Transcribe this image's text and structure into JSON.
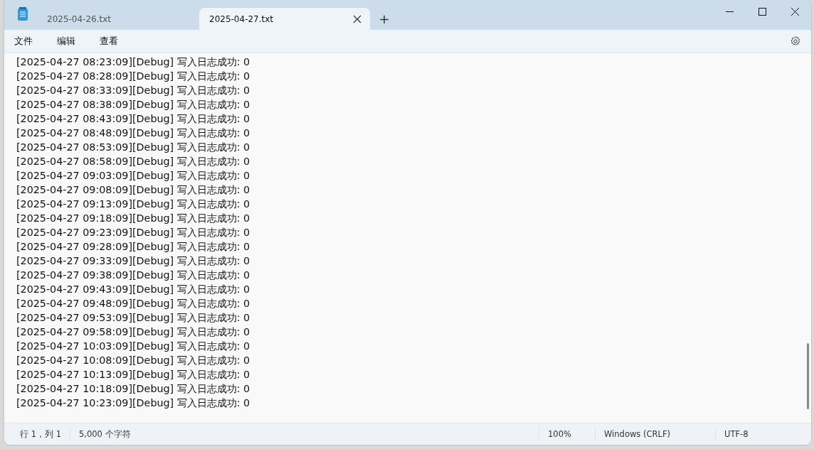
{
  "tabs": [
    {
      "label": "2025-04-26.txt",
      "selected": false
    },
    {
      "label": "2025-04-27.txt",
      "selected": true
    }
  ],
  "new_tab": "+",
  "menu": [
    "文件",
    "编辑",
    "查看"
  ],
  "lines": [
    "[2025-04-27 08:23:09][Debug] 写入日志成功: 0",
    "[2025-04-27 08:28:09][Debug] 写入日志成功: 0",
    "[2025-04-27 08:33:09][Debug] 写入日志成功: 0",
    "[2025-04-27 08:38:09][Debug] 写入日志成功: 0",
    "[2025-04-27 08:43:09][Debug] 写入日志成功: 0",
    "[2025-04-27 08:48:09][Debug] 写入日志成功: 0",
    "[2025-04-27 08:53:09][Debug] 写入日志成功: 0",
    "[2025-04-27 08:58:09][Debug] 写入日志成功: 0",
    "[2025-04-27 09:03:09][Debug] 写入日志成功: 0",
    "[2025-04-27 09:08:09][Debug] 写入日志成功: 0",
    "[2025-04-27 09:13:09][Debug] 写入日志成功: 0",
    "[2025-04-27 09:18:09][Debug] 写入日志成功: 0",
    "[2025-04-27 09:23:09][Debug] 写入日志成功: 0",
    "[2025-04-27 09:28:09][Debug] 写入日志成功: 0",
    "[2025-04-27 09:33:09][Debug] 写入日志成功: 0",
    "[2025-04-27 09:38:09][Debug] 写入日志成功: 0",
    "[2025-04-27 09:43:09][Debug] 写入日志成功: 0",
    "[2025-04-27 09:48:09][Debug] 写入日志成功: 0",
    "[2025-04-27 09:53:09][Debug] 写入日志成功: 0",
    "[2025-04-27 09:58:09][Debug] 写入日志成功: 0",
    "[2025-04-27 10:03:09][Debug] 写入日志成功: 0",
    "[2025-04-27 10:08:09][Debug] 写入日志成功: 0",
    "[2025-04-27 10:13:09][Debug] 写入日志成功: 0",
    "[2025-04-27 10:18:09][Debug] 写入日志成功: 0",
    "[2025-04-27 10:23:09][Debug] 写入日志成功: 0"
  ],
  "status_bar": {
    "position": "行 1，列 1",
    "characters": "5,000 个字符",
    "zoom": "100%",
    "line_ending": "Windows (CRLF)",
    "encoding": "UTF-8"
  }
}
